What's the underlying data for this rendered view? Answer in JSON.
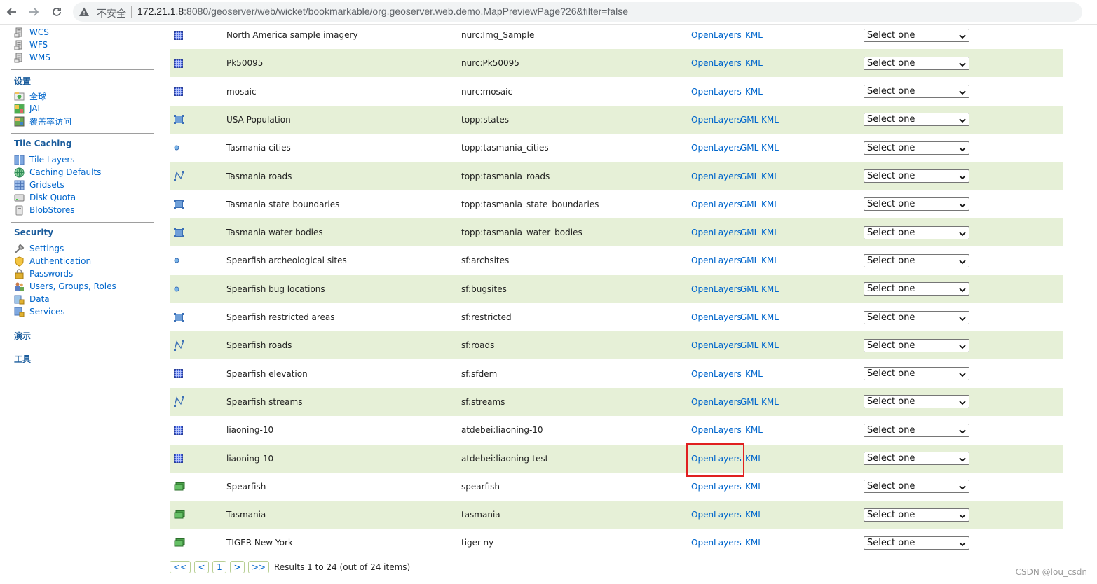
{
  "browser": {
    "security_label": "不安全",
    "url_host": "172.21.1.8",
    "url_rest": ":8080/geoserver/web/wicket/bookmarkable/org.geoserver.web.demo.MapPreviewPage?26&filter=false"
  },
  "sidebar": {
    "services_items": [
      {
        "label": "WCS",
        "icon": "server-icon"
      },
      {
        "label": "WFS",
        "icon": "server-icon"
      },
      {
        "label": "WMS",
        "icon": "server-icon"
      }
    ],
    "settings_title": "设置",
    "settings_items": [
      {
        "label": "全球",
        "icon": "globe-settings-icon"
      },
      {
        "label": "JAI",
        "icon": "image-settings-icon"
      },
      {
        "label": "覆盖率访问",
        "icon": "coverage-icon"
      }
    ],
    "tile_caching_title": "Tile Caching",
    "tile_caching_items": [
      {
        "label": "Tile Layers",
        "icon": "tile-layers-icon"
      },
      {
        "label": "Caching Defaults",
        "icon": "globe-icon"
      },
      {
        "label": "Gridsets",
        "icon": "grid-icon"
      },
      {
        "label": "Disk Quota",
        "icon": "disk-icon"
      },
      {
        "label": "BlobStores",
        "icon": "blobstore-icon"
      }
    ],
    "security_title": "Security",
    "security_items": [
      {
        "label": "Settings",
        "icon": "wrench-icon"
      },
      {
        "label": "Authentication",
        "icon": "shield-icon"
      },
      {
        "label": "Passwords",
        "icon": "lock-icon"
      },
      {
        "label": "Users, Groups, Roles",
        "icon": "users-icon"
      },
      {
        "label": "Data",
        "icon": "data-lock-icon"
      },
      {
        "label": "Services",
        "icon": "services-lock-icon"
      }
    ],
    "demos_title": "演示",
    "tools_title": "工具"
  },
  "table": {
    "rows": [
      {
        "type": "raster",
        "title": "North America sample imagery",
        "name": "nurc:Img_Sample",
        "links": [
          "OpenLayers",
          "KML"
        ],
        "select": "Select one"
      },
      {
        "type": "raster",
        "title": "Pk50095",
        "name": "nurc:Pk50095",
        "links": [
          "OpenLayers",
          "KML"
        ],
        "select": "Select one"
      },
      {
        "type": "raster",
        "title": "mosaic",
        "name": "nurc:mosaic",
        "links": [
          "OpenLayers",
          "KML"
        ],
        "select": "Select one"
      },
      {
        "type": "polygon",
        "title": "USA Population",
        "name": "topp:states",
        "links": [
          "OpenLayers",
          "GML",
          "KML"
        ],
        "select": "Select one"
      },
      {
        "type": "point",
        "title": "Tasmania cities",
        "name": "topp:tasmania_cities",
        "links": [
          "OpenLayers",
          "GML",
          "KML"
        ],
        "select": "Select one"
      },
      {
        "type": "line",
        "title": "Tasmania roads",
        "name": "topp:tasmania_roads",
        "links": [
          "OpenLayers",
          "GML",
          "KML"
        ],
        "select": "Select one"
      },
      {
        "type": "polygon",
        "title": "Tasmania state boundaries",
        "name": "topp:tasmania_state_boundaries",
        "links": [
          "OpenLayers",
          "GML",
          "KML"
        ],
        "select": "Select one"
      },
      {
        "type": "polygon",
        "title": "Tasmania water bodies",
        "name": "topp:tasmania_water_bodies",
        "links": [
          "OpenLayers",
          "GML",
          "KML"
        ],
        "select": "Select one"
      },
      {
        "type": "point",
        "title": "Spearfish archeological sites",
        "name": "sf:archsites",
        "links": [
          "OpenLayers",
          "GML",
          "KML"
        ],
        "select": "Select one"
      },
      {
        "type": "point",
        "title": "Spearfish bug locations",
        "name": "sf:bugsites",
        "links": [
          "OpenLayers",
          "GML",
          "KML"
        ],
        "select": "Select one"
      },
      {
        "type": "polygon",
        "title": "Spearfish restricted areas",
        "name": "sf:restricted",
        "links": [
          "OpenLayers",
          "GML",
          "KML"
        ],
        "select": "Select one"
      },
      {
        "type": "line",
        "title": "Spearfish roads",
        "name": "sf:roads",
        "links": [
          "OpenLayers",
          "GML",
          "KML"
        ],
        "select": "Select one"
      },
      {
        "type": "raster",
        "title": "Spearfish elevation",
        "name": "sf:sfdem",
        "links": [
          "OpenLayers",
          "KML"
        ],
        "select": "Select one"
      },
      {
        "type": "line",
        "title": "Spearfish streams",
        "name": "sf:streams",
        "links": [
          "OpenLayers",
          "GML",
          "KML"
        ],
        "select": "Select one"
      },
      {
        "type": "raster",
        "title": "liaoning-10",
        "name": "atdebei:liaoning-10",
        "links": [
          "OpenLayers",
          "KML"
        ],
        "select": "Select one"
      },
      {
        "type": "raster",
        "title": "liaoning-10",
        "name": "atdebei:liaoning-test",
        "links": [
          "OpenLayers",
          "KML"
        ],
        "select": "Select one"
      },
      {
        "type": "group",
        "title": "Spearfish",
        "name": "spearfish",
        "links": [
          "OpenLayers",
          "KML"
        ],
        "select": "Select one"
      },
      {
        "type": "group",
        "title": "Tasmania",
        "name": "tasmania",
        "links": [
          "OpenLayers",
          "KML"
        ],
        "select": "Select one"
      },
      {
        "type": "group",
        "title": "TIGER New York",
        "name": "tiger-ny",
        "links": [
          "OpenLayers",
          "KML"
        ],
        "select": "Select one"
      }
    ]
  },
  "pager": {
    "first": "<<",
    "prev": "<",
    "page": "1",
    "next": ">",
    "last": ">>",
    "info": "Results 1 to 24 (out of 24 items)"
  },
  "watermark": "CSDN @lou_csdn",
  "colors": {
    "link": "#0066cc",
    "row_alt": "#e6f0d7",
    "highlight": "#e02020"
  }
}
